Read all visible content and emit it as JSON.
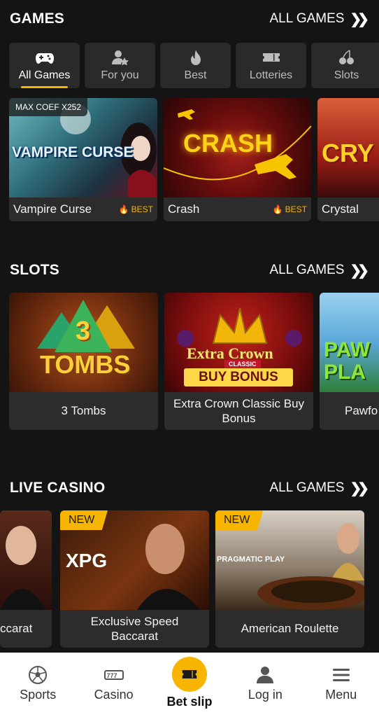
{
  "games_section": {
    "title": "GAMES",
    "all_games": "ALL GAMES"
  },
  "categories": [
    {
      "label": "All Games",
      "icon": "gamepad-icon",
      "active": true
    },
    {
      "label": "For you",
      "icon": "user-star-icon",
      "active": false
    },
    {
      "label": "Best",
      "icon": "flame-icon",
      "active": false
    },
    {
      "label": "Lotteries",
      "icon": "ticket-icon",
      "active": false
    },
    {
      "label": "Slots",
      "icon": "cherry-icon",
      "active": false
    }
  ],
  "games": [
    {
      "name": "Vampire Curse",
      "badge": "MAX COEF X252",
      "tag": "BEST",
      "logo": "VAMPIRE CURSE"
    },
    {
      "name": "Crash",
      "tag": "BEST",
      "logo": "CRASH"
    },
    {
      "name": "Crystal",
      "logo": "CRY"
    }
  ],
  "slots_section": {
    "title": "SLOTS",
    "all_games": "ALL GAMES"
  },
  "slots": [
    {
      "name": "3 Tombs",
      "logo_top": "3",
      "logo": "TOMBS"
    },
    {
      "name": "Extra Crown Classic Buy Bonus",
      "logo": "Extra Crown",
      "logo_sub": "CLASSIC",
      "logo_btn": "BUY BONUS"
    },
    {
      "name": "Pawfo",
      "logo": "PAW PLA"
    }
  ],
  "live_section": {
    "title": "LIVE CASINO",
    "all_games": "ALL GAMES"
  },
  "live": [
    {
      "name": "ccarat"
    },
    {
      "name": "Exclusive Speed Baccarat",
      "badge": "NEW",
      "logo": "XPG"
    },
    {
      "name": "American Roulette",
      "badge": "NEW",
      "logo": "PRAGMATIC PLAY"
    }
  ],
  "nav": [
    {
      "label": "Sports",
      "icon": "soccer-ball-icon"
    },
    {
      "label": "Casino",
      "icon": "slot-777-icon"
    },
    {
      "label": "Bet slip",
      "icon": "ticket-icon"
    },
    {
      "label": "Log in",
      "icon": "user-icon"
    },
    {
      "label": "Menu",
      "icon": "menu-icon"
    }
  ],
  "colors": {
    "accent": "#f7b500",
    "background": "#141414",
    "card": "#2c2c2c"
  }
}
